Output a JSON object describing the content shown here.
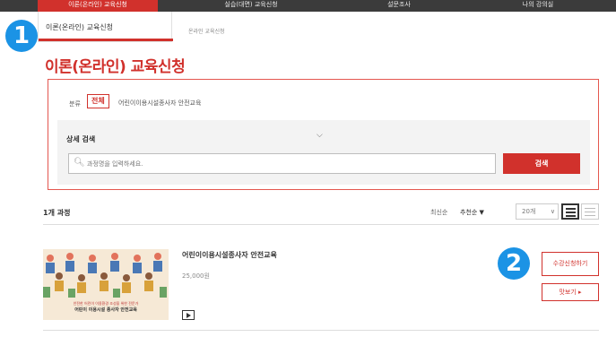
{
  "topnav": {
    "items": [
      {
        "label": "이론(온라인) 교육신청"
      },
      {
        "label": "실습(대면) 교육신청"
      },
      {
        "label": "설문조사"
      },
      {
        "label": "나의 강의실"
      }
    ],
    "active_color": "#d1312c"
  },
  "submenu": {
    "item": "이론(온라인) 교육신청"
  },
  "breadcrumb": "온라인 교육신청",
  "page": {
    "title": "이론(온라인) 교육신청"
  },
  "badges": {
    "one": "1",
    "two": "2",
    "color": "#1b93e5"
  },
  "filter": {
    "category_label": "분류",
    "category_all": "전체",
    "category_item": "어린이이용시설종사자 안전교육",
    "search_title": "상세 검색",
    "search_placeholder": "과정명을 입력하세요.",
    "search_button": "검색"
  },
  "results": {
    "count": "1개 과정",
    "sort_latest": "최신순",
    "sort_recommended": "추천순 ▼",
    "per_page": "20개",
    "courses": [
      {
        "title": "어린이이용시설종사자 안전교육",
        "price": "25,000원",
        "thumb_caption1": "안전한 어린이 이용환경 조성을 위한 전문가",
        "thumb_caption2": "어린이 이용시설 종사자 안전교육",
        "enroll_label": "수강신청하기",
        "preview_label": "맛보기 ▸"
      }
    ]
  },
  "colors": {
    "accent": "#d1312c",
    "nav_bg": "#3b3b3b"
  }
}
